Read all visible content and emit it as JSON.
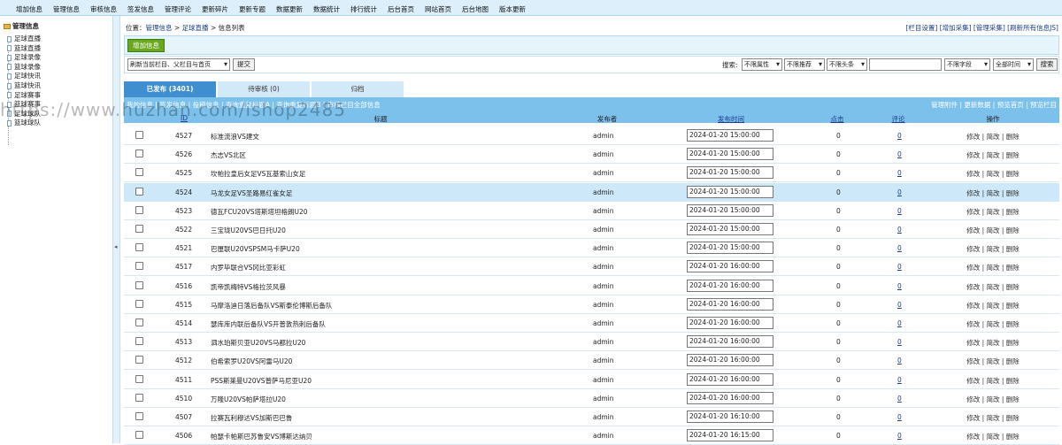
{
  "topnav": [
    "增加信息",
    "管理信息",
    "审核信息",
    "签发信息",
    "管理评论",
    "更新碎片",
    "更新专题",
    "数据更新",
    "数据统计",
    "排行统计",
    "后台首页",
    "网站首页",
    "后台地图",
    "版本更新"
  ],
  "sidebar": {
    "root": "管理信息",
    "items": [
      "足球直播",
      "篮球直播",
      "足球录像",
      "篮球录像",
      "足球快讯",
      "篮球快讯",
      "足球赛事",
      "篮球赛事",
      "足球球队",
      "篮球球队"
    ]
  },
  "splitter_arrow": "◂",
  "location": {
    "prefix": "位置：",
    "crumbs": [
      "管理信息",
      "足球直播",
      "信息列表"
    ],
    "sep": " > "
  },
  "toplinks": "[栏目设置] [增加采集] [管理采集] [刷新所有信息JS]",
  "add_button": "增加信息",
  "filter": {
    "refresh_select": "刷新当前栏目、父栏目与首页",
    "submit": "提交",
    "search_label": "搜索:",
    "sel_attr": "不限属性",
    "sel_rec": "不限推荐",
    "sel_head": "不限头条",
    "search_value": "",
    "sel_field": "不限字段",
    "sel_time": "全部时间",
    "search_btn": "搜索"
  },
  "tabs": [
    "已发布 (3401)",
    "待审核 (0)",
    "归档"
  ],
  "header": {
    "left_links": "我的信息 | 签发信息 | 投稿信息 | 查询重复标题A | 查询重复标题B | 审核栏目全部信息",
    "right_links": "管理附件 | 更新数据 | 预览首页 | 预览栏目",
    "col_id": "ID",
    "col_title": "标题",
    "col_publisher": "发布者",
    "col_time": "发布时间",
    "col_clicks": "点击",
    "col_comments": "评论",
    "col_ops": "操作"
  },
  "rows": [
    {
      "id": "4527",
      "title": "标准流浪VS建文",
      "publisher": "admin",
      "time": "2024-01-20 15:00:00",
      "clicks": "0",
      "comments": "0",
      "ops": "修改 | 简改 | 删除"
    },
    {
      "id": "4526",
      "title": "杰志VS北区",
      "publisher": "admin",
      "time": "2024-01-20 15:00:00",
      "clicks": "0",
      "comments": "0",
      "ops": "修改 | 简改 | 删除"
    },
    {
      "id": "4525",
      "title": "坎帕拉皇后女足VS瓦基索山女足",
      "publisher": "admin",
      "time": "2024-01-20 15:00:00",
      "clicks": "0",
      "comments": "0",
      "ops": "修改 | 简改 | 删除"
    },
    {
      "id": "4524",
      "title": "马龙女足VS圣路易红雀女足",
      "publisher": "admin",
      "time": "2024-01-20 15:00:00",
      "clicks": "0",
      "comments": "0",
      "ops": "修改 | 简改 | 删除"
    },
    {
      "id": "4523",
      "title": "德瓦FCU20VS塔斯塔坦格朗U20",
      "publisher": "admin",
      "time": "2024-01-20 15:00:00",
      "clicks": "0",
      "comments": "0",
      "ops": "修改 | 简改 | 删除"
    },
    {
      "id": "4522",
      "title": "三宝珑U20VS巴日托U20",
      "publisher": "admin",
      "time": "2024-01-20 15:00:00",
      "clicks": "0",
      "comments": "0",
      "ops": "修改 | 简改 | 删除"
    },
    {
      "id": "4521",
      "title": "巴厘联U20VSPSM马卡萨U20",
      "publisher": "admin",
      "time": "2024-01-20 15:00:00",
      "clicks": "0",
      "comments": "0",
      "ops": "修改 | 简改 | 删除"
    },
    {
      "id": "4517",
      "title": "内罗毕联合VS冈比亚彩虹",
      "publisher": "admin",
      "time": "2024-01-20 16:00:00",
      "clicks": "0",
      "comments": "0",
      "ops": "修改 | 简改 | 删除"
    },
    {
      "id": "4516",
      "title": "凯帝凯梅特VS格拉茨风暴",
      "publisher": "admin",
      "time": "2024-01-20 16:00:00",
      "clicks": "0",
      "comments": "0",
      "ops": "修改 | 简改 | 删除"
    },
    {
      "id": "4515",
      "title": "马摩洛迪日落后备队VS斯泰伦博斯后备队",
      "publisher": "admin",
      "time": "2024-01-20 16:00:00",
      "clicks": "0",
      "comments": "0",
      "ops": "修改 | 简改 | 删除"
    },
    {
      "id": "4514",
      "title": "瑟库库内联后备队VS开普敦热刺后备队",
      "publisher": "admin",
      "time": "2024-01-20 16:00:00",
      "clicks": "0",
      "comments": "0",
      "ops": "修改 | 简改 | 删除"
    },
    {
      "id": "4513",
      "title": "泗水珀斯贝亚U20VS马都拉U20",
      "publisher": "admin",
      "time": "2024-01-20 16:00:00",
      "clicks": "0",
      "comments": "0",
      "ops": "修改 | 简改 | 删除"
    },
    {
      "id": "4512",
      "title": "伯希索罗U20VS阿雷马U20",
      "publisher": "admin",
      "time": "2024-01-20 16:00:00",
      "clicks": "0",
      "comments": "0",
      "ops": "修改 | 简改 | 删除"
    },
    {
      "id": "4511",
      "title": "PSS斯莱曼U20VS普萨马尼亚U20",
      "publisher": "admin",
      "time": "2024-01-20 16:00:00",
      "clicks": "0",
      "comments": "0",
      "ops": "修改 | 简改 | 删除"
    },
    {
      "id": "4510",
      "title": "万隆U20VS帕萨塔拉U20",
      "publisher": "admin",
      "time": "2024-01-20 16:00:00",
      "clicks": "0",
      "comments": "0",
      "ops": "修改 | 简改 | 删除"
    },
    {
      "id": "4507",
      "title": "拉赛瓦利穆达VS加斯巴巴鲁",
      "publisher": "admin",
      "time": "2024-01-20 16:10:00",
      "clicks": "0",
      "comments": "0",
      "ops": "修改 | 简改 | 删除"
    },
    {
      "id": "4506",
      "title": "帕瑟卡帕斯巴苏鲁安VS博斯达纳贝",
      "publisher": "admin",
      "time": "2024-01-20 16:15:00",
      "clicks": "0",
      "comments": "0",
      "ops": "修改 | 简改 | 删除"
    }
  ],
  "selected_row_index": 3,
  "watermark": "https://www.huzhan.com/ishop2485"
}
